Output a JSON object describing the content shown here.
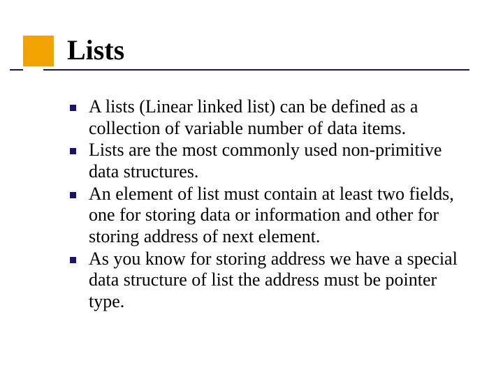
{
  "title": "Lists",
  "bullets": [
    "A lists (Linear linked list) can be defined as a collection of variable number of data items.",
    "Lists are the most commonly used non-primitive data structures.",
    "An element of list must contain at least two fields, one for storing data or information and other for storing address of next element.",
    "As you know for storing address we have a special data structure of list the address must be pointer type."
  ],
  "colors": {
    "accent_square": "#f2a300",
    "rule_line": "#1b1464",
    "bullet": "#1b1464"
  }
}
